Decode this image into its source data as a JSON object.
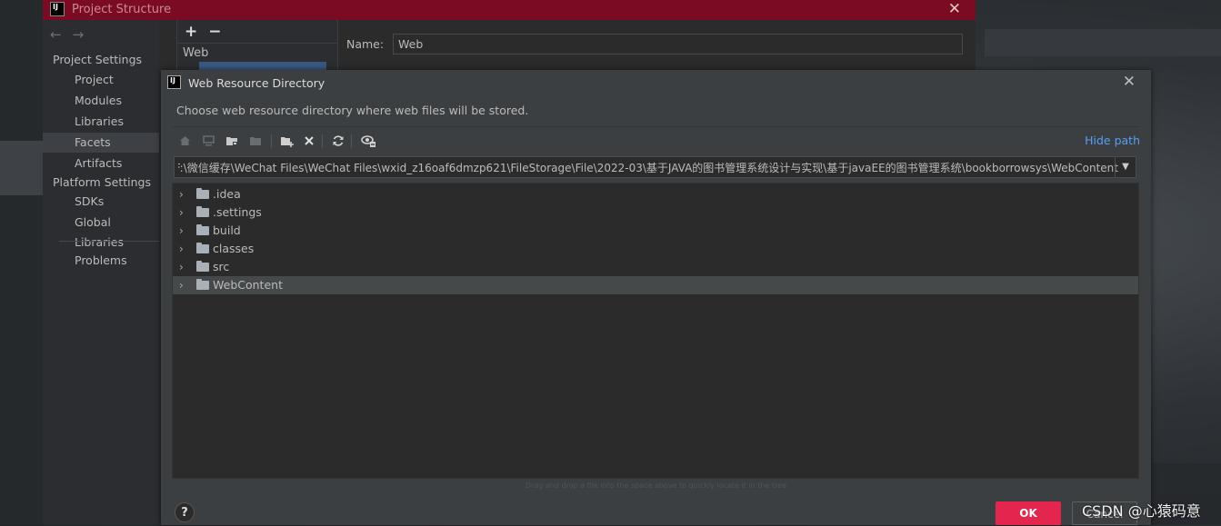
{
  "project_structure": {
    "title": "Project Structure",
    "nav": {
      "back": "←",
      "forward": "→"
    },
    "sidebar": {
      "project_settings_heading": "Project Settings",
      "items": [
        "Project",
        "Modules",
        "Libraries",
        "Facets",
        "Artifacts"
      ],
      "selected": "Facets",
      "platform_settings_heading": "Platform Settings",
      "platform_items": [
        "SDKs",
        "Global Libraries"
      ],
      "problems": "Problems"
    },
    "facets_panel": {
      "add": "+",
      "remove": "−",
      "item": "Web"
    },
    "name_label": "Name:",
    "name_value": "Web"
  },
  "dialog": {
    "title": "Web Resource Directory",
    "description": "Choose web resource directory where web files will be stored.",
    "toolbar_icons": [
      "home-icon",
      "desktop-icon",
      "project-folder-icon",
      "module-folder-icon",
      "new-folder-icon",
      "delete-icon",
      "refresh-icon",
      "show-hidden-icon"
    ],
    "hide_path_link": "Hide path",
    "path": "F:\\微信缓存\\WeChat Files\\WeChat Files\\wxid_z16oaf6dmzp621\\FileStorage\\File\\2022-03\\基于JAVA的图书管理系统设计与实现\\基于javaEE的图书管理系统\\bookborrowsys\\WebContent",
    "tree": [
      {
        "name": ".idea"
      },
      {
        "name": ".settings"
      },
      {
        "name": "build"
      },
      {
        "name": "classes"
      },
      {
        "name": "src"
      },
      {
        "name": "WebContent",
        "selected": true
      }
    ],
    "drag_hint": "Drag and drop a file into the space above to quickly locate it in the tree",
    "help": "?",
    "ok": "OK",
    "cancel": "Cancel"
  },
  "watermark": "CSDN @心猿码意",
  "colors": {
    "titlebar": "#7a0b22",
    "ok_button": "#e4254d",
    "link": "#589df6",
    "selection": "#45494a"
  }
}
